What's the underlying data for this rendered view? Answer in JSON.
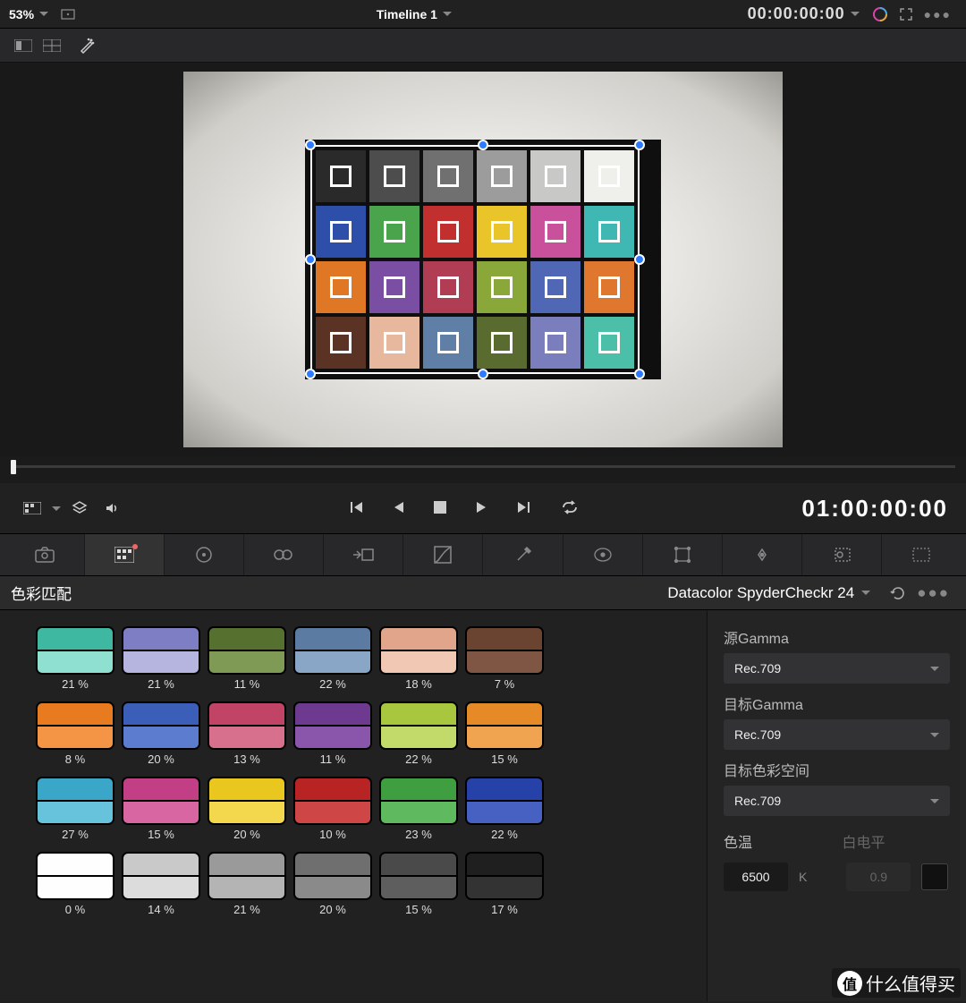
{
  "header": {
    "zoom": "53%",
    "timeline_title": "Timeline 1",
    "timecode": "00:00:00:00"
  },
  "transport": {
    "timecode": "01:00:00:00"
  },
  "panel": {
    "title": "色彩匹配",
    "chart_name": "Datacolor SpyderCheckr 24"
  },
  "side": {
    "src_gamma_label": "源Gamma",
    "src_gamma": "Rec.709",
    "tgt_gamma_label": "目标Gamma",
    "tgt_gamma": "Rec.709",
    "tgt_space_label": "目标色彩空间",
    "tgt_space": "Rec.709",
    "temp_label": "色温",
    "temp_value": "6500",
    "temp_unit": "K",
    "white_label": "白电平",
    "white_value": "0.9"
  },
  "viewer_chart": [
    [
      "#2a2a2a",
      "#4d4d4d",
      "#707070",
      "#9c9c9c",
      "#c8c8c6",
      "#efefec"
    ],
    [
      "#2d4fa9",
      "#4aa44b",
      "#c12f2f",
      "#e9c529",
      "#c9509a",
      "#3fb7b2"
    ],
    [
      "#e07724",
      "#7a4fa3",
      "#b13d54",
      "#8aa73a",
      "#4f67b4",
      "#e0772e"
    ],
    [
      "#5a3324",
      "#e7b79e",
      "#5f7fa7",
      "#5a6b2f",
      "#7b7ebc",
      "#4cbfa8"
    ]
  ],
  "swatches": [
    {
      "top": "#3fb8a1",
      "bot": "#8fe0d0",
      "pct": "21 %"
    },
    {
      "top": "#7e7ec4",
      "bot": "#b5b5e0",
      "pct": "21 %"
    },
    {
      "top": "#55702f",
      "bot": "#7f9a55",
      "pct": "11 %"
    },
    {
      "top": "#5b7ba3",
      "bot": "#8aa6c6",
      "pct": "22 %"
    },
    {
      "top": "#e0a58a",
      "bot": "#f1c8b4",
      "pct": "18 %"
    },
    {
      "top": "#6b4431",
      "bot": "#7f5643",
      "pct": "7 %"
    },
    {
      "top": "#e87a1f",
      "bot": "#f39545",
      "pct": "8 %"
    },
    {
      "top": "#3b5fb8",
      "bot": "#5c7cd0",
      "pct": "20 %"
    },
    {
      "top": "#c14466",
      "bot": "#d6708c",
      "pct": "13 %"
    },
    {
      "top": "#6d3a8f",
      "bot": "#8a56ab",
      "pct": "11 %"
    },
    {
      "top": "#a9c63f",
      "bot": "#c2da6a",
      "pct": "22 %"
    },
    {
      "top": "#e58a27",
      "bot": "#f1a44f",
      "pct": "15 %"
    },
    {
      "top": "#3aa7c8",
      "bot": "#67c2db",
      "pct": "27 %"
    },
    {
      "top": "#c23f85",
      "bot": "#d866a3",
      "pct": "15 %"
    },
    {
      "top": "#e9c71f",
      "bot": "#f3d84e",
      "pct": "20 %"
    },
    {
      "top": "#b82424",
      "bot": "#cf4646",
      "pct": "10 %"
    },
    {
      "top": "#3f9e3f",
      "bot": "#5fba5f",
      "pct": "23 %"
    },
    {
      "top": "#2642a8",
      "bot": "#4761c2",
      "pct": "22 %"
    },
    {
      "top": "#fefefe",
      "bot": "#fefefe",
      "pct": "0 %"
    },
    {
      "top": "#c9c9c9",
      "bot": "#dcdcdc",
      "pct": "14 %"
    },
    {
      "top": "#9a9a9a",
      "bot": "#b4b4b4",
      "pct": "21 %"
    },
    {
      "top": "#6f6f6f",
      "bot": "#8a8a8a",
      "pct": "20 %"
    },
    {
      "top": "#4a4a4a",
      "bot": "#5e5e5e",
      "pct": "15 %"
    },
    {
      "top": "#1f1f1f",
      "bot": "#333333",
      "pct": "17 %"
    }
  ],
  "watermark": "什么值得买"
}
